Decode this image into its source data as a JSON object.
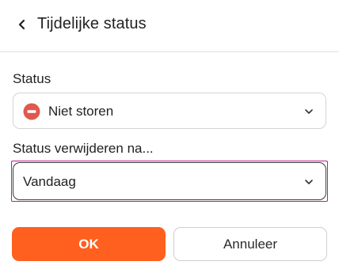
{
  "header": {
    "title": "Tijdelijke status",
    "back_icon": "chevron-left-icon"
  },
  "status": {
    "label": "Status",
    "value": "Niet storen",
    "icon": "do-not-disturb-icon",
    "icon_color": "#e0584e"
  },
  "remove_after": {
    "label": "Status verwijderen na...",
    "value": "Vandaag",
    "focus_color": "#c1198a"
  },
  "actions": {
    "ok_label": "OK",
    "cancel_label": "Annuleer",
    "primary_color": "#ff5f1f"
  }
}
